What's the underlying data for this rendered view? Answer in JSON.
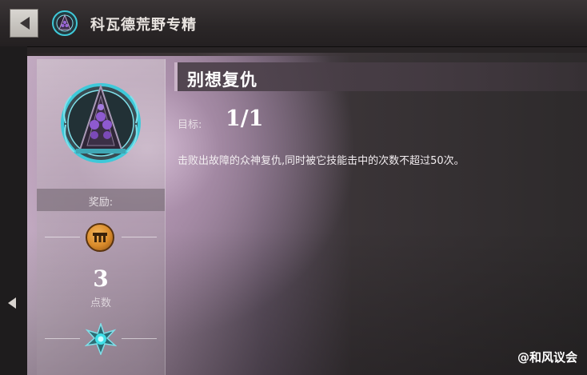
{
  "header": {
    "title": "科瓦德荒野专精",
    "back_icon": "back-arrow-icon",
    "emblem_icon": "mastery-emblem-icon"
  },
  "achievement": {
    "title": "别想复仇",
    "goal_label": "目标:",
    "goal_value": "1/1",
    "description": "击败出故障的众神复仇,同时被它技能击中的次数不超过50次。",
    "badge_icon": "achievement-badge-icon"
  },
  "rewards": {
    "label": "奖励:",
    "item_icon": "coin-reward-icon",
    "points": "3",
    "points_label": "点数",
    "mastery_icon": "mastery-star-icon"
  },
  "watermark": "@和风议会",
  "colors": {
    "accent": "#c9b3c7",
    "coin": "#d88a2a",
    "badge_ring": "#3fc9d9",
    "badge_gems": "#8e5ad0"
  }
}
